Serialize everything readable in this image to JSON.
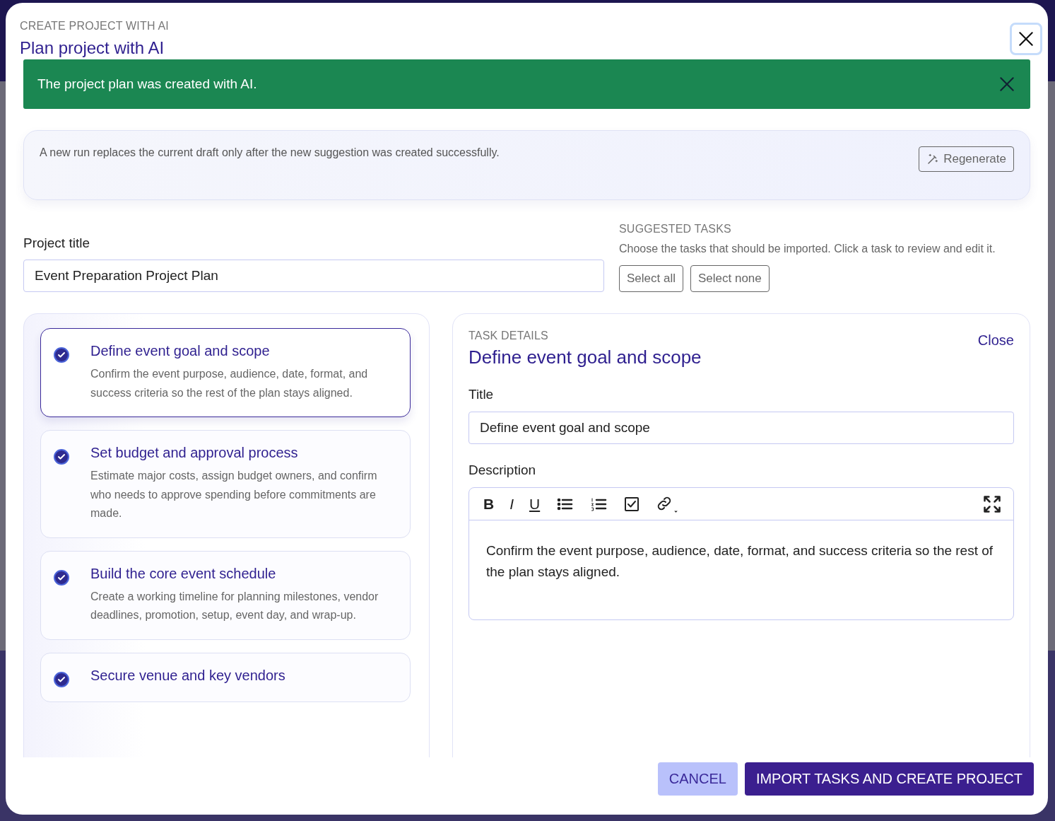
{
  "dialog": {
    "eyebrow": "CREATE PROJECT WITH AI",
    "title": "Plan project with AI"
  },
  "alert": {
    "message": "The project plan was created with AI."
  },
  "info": {
    "text": "A new run replaces the current draft only after the new suggestion was created successfully.",
    "button": "Regenerate"
  },
  "project_title": {
    "label": "Project title",
    "value": "Event Preparation Project Plan"
  },
  "suggested": {
    "eyebrow": "SUGGESTED TASKS",
    "description": "Choose the tasks that should be imported. Click a task to review and edit it.",
    "buttons": [
      "Select all",
      "Select none"
    ]
  },
  "tasks": [
    {
      "title": "Define event goal and scope",
      "description": "Confirm the event purpose, audience, date, format, and success criteria so the rest of the plan stays aligned.",
      "checked": true,
      "selected": true
    },
    {
      "title": "Set budget and approval process",
      "description": "Estimate major costs, assign budget owners, and confirm who needs to approve spending before commitments are made.",
      "checked": true,
      "selected": false
    },
    {
      "title": "Build the core event schedule",
      "description": "Create a working timeline for planning milestones, vendor deadlines, promotion, setup, event day, and wrap-up.",
      "checked": true,
      "selected": false
    },
    {
      "title": "Secure venue and key vendors",
      "checked": true,
      "selected": false
    }
  ],
  "details": {
    "eyebrow": "TASK DETAILS",
    "title": "Define event goal and scope",
    "close": "Close",
    "title_label": "Title",
    "title_value": "Define event goal and scope",
    "description_label": "Description",
    "toolbar": [
      {
        "kind": "bold",
        "label": "B"
      },
      {
        "kind": "italic",
        "label": "I"
      },
      {
        "kind": "underline",
        "label": "U"
      },
      {
        "kind": "bullets"
      },
      {
        "kind": "numbers"
      },
      {
        "kind": "checklist"
      },
      {
        "kind": "link"
      },
      {
        "kind": "fullscreen"
      }
    ],
    "description": "Confirm the event purpose, audience, date, format, and success criteria so the rest of the plan stays aligned."
  },
  "footer": {
    "buttons": [
      {
        "kind": "secondary",
        "label": "CANCEL"
      },
      {
        "kind": "primary",
        "label": "IMPORT TASKS AND CREATE PROJECT"
      }
    ]
  }
}
